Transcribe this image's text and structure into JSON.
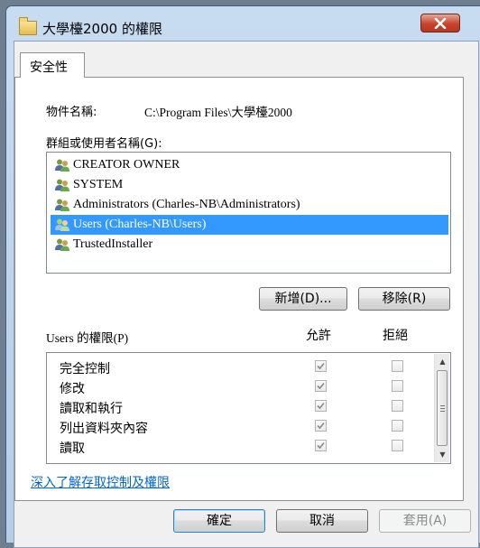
{
  "window": {
    "title": "大學檯2000 的權限",
    "folder_icon": "folder-icon",
    "close_icon": "close-icon",
    "accent": "#3399ff"
  },
  "tab": {
    "label": "安全性"
  },
  "object": {
    "label": "物件名稱:",
    "value": "C:\\Program Files\\大學檯2000"
  },
  "groups": {
    "label": "群組或使用者名稱(G):",
    "items": [
      {
        "label": "CREATOR OWNER",
        "icon": "user-group-icon",
        "selected": false
      },
      {
        "label": "SYSTEM",
        "icon": "user-group-icon",
        "selected": false
      },
      {
        "label": "Administrators (Charles-NB\\Administrators)",
        "icon": "user-group-icon",
        "selected": false
      },
      {
        "label": "Users (Charles-NB\\Users)",
        "icon": "user-group-icon",
        "selected": true
      },
      {
        "label": "TrustedInstaller",
        "icon": "user-group-icon",
        "selected": false
      }
    ]
  },
  "buttons": {
    "add": "新增(D)...",
    "remove": "移除(R)"
  },
  "permissions": {
    "label": "Users 的權限(P)",
    "allow_header": "允許",
    "deny_header": "拒絕",
    "rows": [
      {
        "name": "完全控制",
        "allow": true,
        "deny": false
      },
      {
        "name": "修改",
        "allow": true,
        "deny": false
      },
      {
        "name": "讀取和執行",
        "allow": true,
        "deny": false
      },
      {
        "name": "列出資料夾內容",
        "allow": true,
        "deny": false
      },
      {
        "name": "讀取",
        "allow": true,
        "deny": false
      }
    ]
  },
  "link": "深入了解存取控制及權限",
  "footer": {
    "ok": "確定",
    "cancel": "取消",
    "apply": "套用(A)"
  }
}
